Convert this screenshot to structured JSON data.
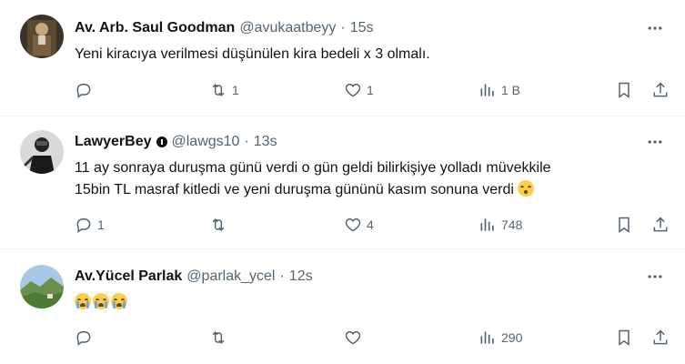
{
  "tweets": [
    {
      "name": "Av. Arb. Saul Goodman",
      "handle": "@avukaatbeyy",
      "separator": "·",
      "time": "15s",
      "text": "Yeni kiracıya verilmesi düşünülen kira bedeli x 3 olmalı.",
      "replies": "",
      "retweets": "1",
      "likes": "1",
      "views": "1 B",
      "verified": false
    },
    {
      "name": "LawyerBey",
      "handle": "@lawgs10",
      "separator": "·",
      "time": "13s",
      "text_line1": "11 ay sonraya duruşma günü verdi o gün geldi bilirkişiye yolladı müvekkile",
      "text_line2": "15bin TL masraf kitledi ve yeni duruşma gününü kasım sonuna verdi",
      "replies": "1",
      "retweets": "",
      "likes": "4",
      "views": "748",
      "verified": true
    },
    {
      "name": "Av.Yücel Parlak",
      "handle": "@parlak_ycel",
      "separator": "·",
      "time": "12s",
      "emoji_count": 3,
      "replies": "",
      "retweets": "",
      "likes": "",
      "views": "290",
      "verified": false
    }
  ],
  "icons": {
    "reply": "reply-icon",
    "retweet": "retweet-icon",
    "like": "heart-icon",
    "views": "views-icon",
    "bookmark": "bookmark-icon",
    "share": "share-icon",
    "more": "more-dots-icon"
  },
  "colors": {
    "text": "#0f1419",
    "secondary": "#536471",
    "divider": "#eff3f4"
  }
}
